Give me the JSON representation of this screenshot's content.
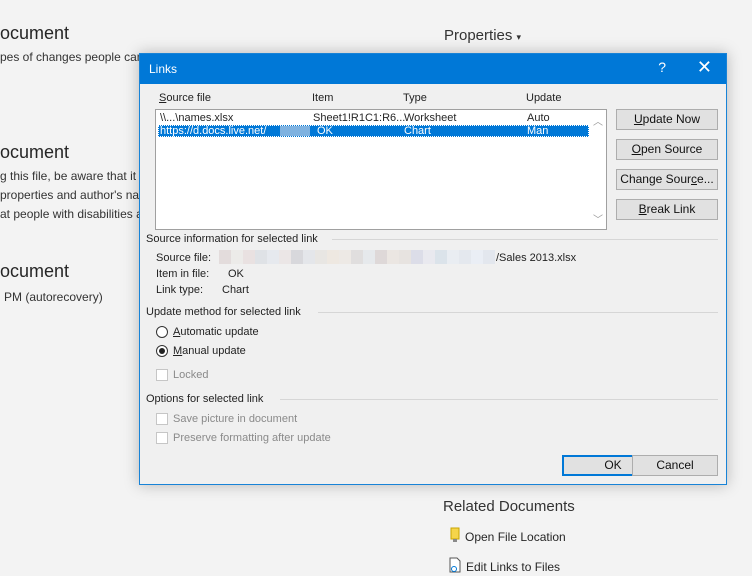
{
  "background": {
    "heading1": "ocument",
    "text1": "pes of changes people can",
    "heading2": "ocument",
    "text2a": "g this file, be aware that it",
    "text2b": "properties and author's na",
    "text2c": "at people with disabilities a",
    "heading3": "ocument",
    "text3": "PM (autorecovery)",
    "properties": "Properties",
    "related_documents": "Related Documents",
    "open_file_location": "Open File Location",
    "edit_links": "Edit Links to Files"
  },
  "dialog": {
    "title": "Links",
    "help": "?",
    "close": "✕",
    "columns": {
      "source": {
        "pre": "",
        "u": "S",
        "post": "ource file"
      },
      "item": "Item",
      "type": "Type",
      "update": "Update"
    },
    "rows": [
      {
        "source": "\\\\...\\names.xlsx",
        "item": "Sheet1!R1C1:R6...",
        "type": "Worksheet",
        "update": "Auto"
      },
      {
        "source": "https://d.docs.live.net/",
        "item": "OK",
        "type": "Chart",
        "update": "Man"
      }
    ],
    "buttons": {
      "update_now": {
        "u": "U",
        "rest": "pdate Now"
      },
      "open_source": {
        "u": "O",
        "rest": "pen Source"
      },
      "change_source": {
        "pre": "Change Sour",
        "u": "c",
        "rest": "e..."
      },
      "break_link": {
        "u": "B",
        "rest": "reak Link"
      },
      "ok": "OK",
      "cancel": "Cancel"
    },
    "source_info": {
      "heading": "Source information for selected link",
      "source_file_label": "Source file:",
      "source_file_value": "/Sales 2013.xlsx",
      "item_label": "Item in file:",
      "item_value": "OK",
      "type_label": "Link type:",
      "type_value": "Chart"
    },
    "update_method": {
      "heading": "Update method for selected link",
      "automatic": {
        "u": "A",
        "rest": "utomatic update"
      },
      "manual": {
        "u": "M",
        "rest": "anual update"
      },
      "selected": "manual",
      "locked": "Locked"
    },
    "options": {
      "heading": "Options for selected link",
      "save_picture": "Save picture in document",
      "preserve_formatting": "Preserve formatting after update"
    }
  },
  "colors": {
    "accent": "#0078d7",
    "dialog_bg": "#f0f0f0"
  }
}
